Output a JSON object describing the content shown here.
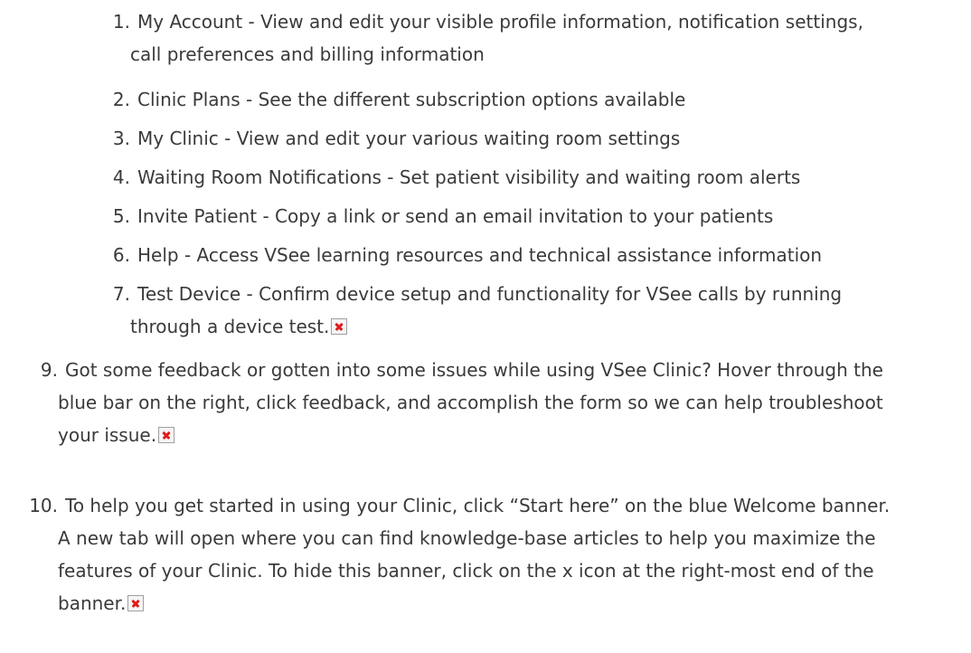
{
  "sub_items": [
    {
      "num": "1.",
      "text": "My Account - View and edit your visible profile information, notification settings, call preferences and billing information"
    },
    {
      "num": "2.",
      "text": "Clinic Plans - See the different subscription options available"
    },
    {
      "num": "3.",
      "text": "My Clinic - View and edit your various waiting room settings"
    },
    {
      "num": "4.",
      "text": "Waiting Room Notifications - Set patient visibility and waiting room alerts"
    },
    {
      "num": "5.",
      "text": "Invite Patient - Copy a link or send an email invitation to your patients"
    },
    {
      "num": "6.",
      "text": "Help - Access VSee learning resources and technical assistance information"
    },
    {
      "num": "7.",
      "text": "Test Device - Confirm device setup and functionality for VSee calls by running through a device test."
    }
  ],
  "main_items": [
    {
      "num": "9.",
      "text": "Got some feedback or gotten into some issues while using VSee Clinic? Hover through the blue bar on the right, click feedback, and accomplish the form so we can help troubleshoot your issue."
    },
    {
      "num": "10.",
      "text": "To help you get started in using your Clinic, click “Start here” on the blue Welcome banner. A new tab will open where you can find knowledge-base articles to help you maximize the features of your Clinic. To hide this banner, click on the x icon at the right-most end of the banner."
    }
  ],
  "broken_image_icon": "broken-image-icon"
}
